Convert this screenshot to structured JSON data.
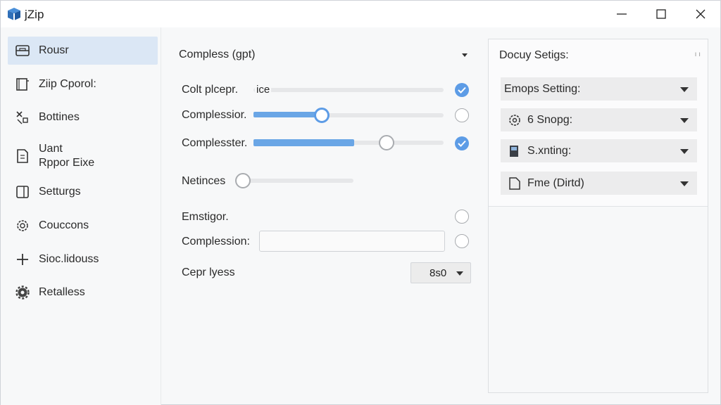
{
  "window": {
    "title": "jZip"
  },
  "sidebar": {
    "items": [
      {
        "label": "Rousr",
        "icon": "archive-icon",
        "active": true
      },
      {
        "label": "Ziip Cporol:",
        "icon": "box-icon",
        "active": false
      },
      {
        "label": "Bottines",
        "icon": "split-icon",
        "active": false
      },
      {
        "label": "Uant\nRppor Eixe",
        "icon": "file-icon",
        "active": false
      },
      {
        "label": "Setturgs",
        "icon": "panel-icon",
        "active": false
      },
      {
        "label": "Couccons",
        "icon": "gear-outline-icon",
        "active": false
      },
      {
        "label": "Sioc.lidouss",
        "icon": "plus-icon",
        "active": false
      },
      {
        "label": "Retalless",
        "icon": "gear-icon",
        "active": false
      }
    ]
  },
  "main": {
    "header_dropdown": "Compless (gpt)",
    "rows": {
      "colt_label": "Colt plcepr.",
      "colt_suffix": "ice",
      "compression_label": "Complessior.",
      "compresster_label": "Complesster.",
      "netinces_label": "Netinces",
      "emstigor_label": "Emstigor.",
      "compression2_label": "Complession:",
      "cepr_label": "Cepr lyess",
      "cepr_value": "8s0"
    },
    "values": {
      "compression_slider": 0.36,
      "compresster_slider": 0.7,
      "compresster_fill": 0.53,
      "netinces_slider": 0.0
    }
  },
  "panel": {
    "title": "Docuy Setigs:",
    "mini": "ı ı",
    "rows": [
      {
        "label": "Emops Setting:",
        "icon": ""
      },
      {
        "label": "6 Snopg:",
        "icon": "gear-outline-icon"
      },
      {
        "label": "S.xnting:",
        "icon": "box-icon"
      },
      {
        "label": "Fme (Dirtd)",
        "icon": "file-icon"
      }
    ]
  },
  "colors": {
    "accent": "#5d9ce6",
    "active_nav": "#dbe7f5"
  }
}
